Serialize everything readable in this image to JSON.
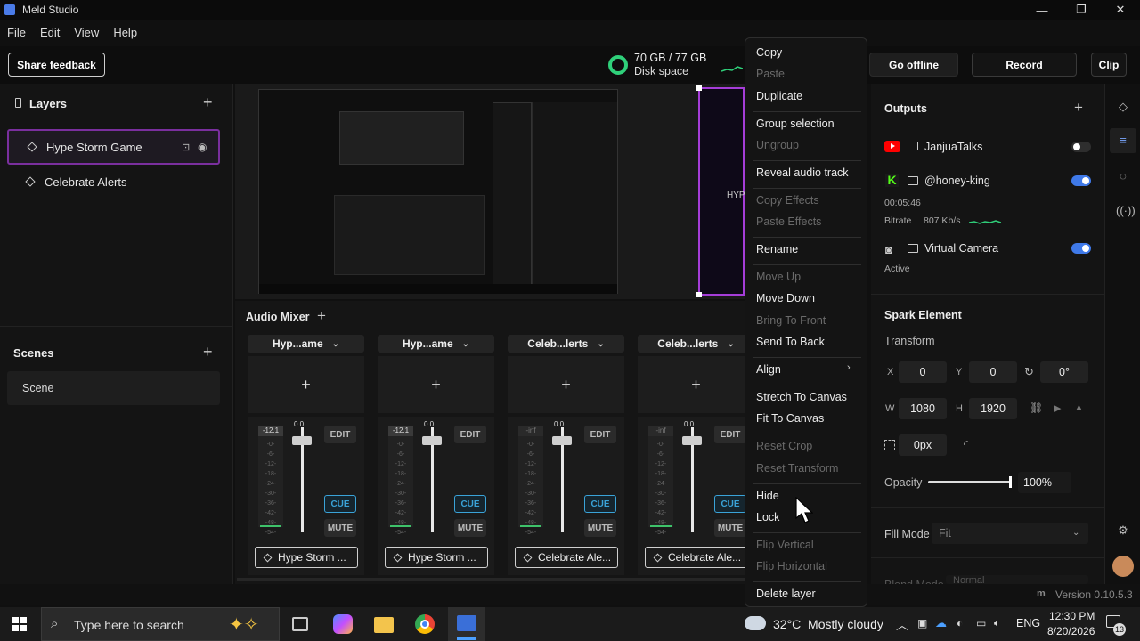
{
  "app": {
    "title": "Meld Studio"
  },
  "menu": [
    "File",
    "Edit",
    "View",
    "Help"
  ],
  "toolbar": {
    "share_feedback": "Share feedback",
    "disk_usage": "70 GB / 77 GB",
    "disk_label": "Disk space",
    "go_offline": "Go offline",
    "record": "Record",
    "clip": "Clip"
  },
  "layers": {
    "title": "Layers",
    "items": [
      {
        "label": "Hype Storm Game"
      },
      {
        "label": "Celebrate Alerts"
      }
    ]
  },
  "scenes": {
    "title": "Scenes",
    "items": [
      {
        "label": "Scene"
      }
    ]
  },
  "audio_mixer": {
    "title": "Audio Mixer",
    "strips": [
      {
        "header": "Hyp...ame",
        "level": "-12.1",
        "fader_value": "0.0",
        "edit": "EDIT",
        "cue": "CUE",
        "mute": "MUTE",
        "source": "Hype Storm ..."
      },
      {
        "header": "Hyp...ame",
        "level": "-12.1",
        "fader_value": "0.0",
        "edit": "EDIT",
        "cue": "CUE",
        "mute": "MUTE",
        "source": "Hype Storm ..."
      },
      {
        "header": "Celeb...lerts",
        "level": "-inf",
        "fader_value": "0.0",
        "edit": "EDIT",
        "cue": "CUE",
        "mute": "MUTE",
        "source": "Celebrate Ale..."
      },
      {
        "header": "Celeb...lerts",
        "level": "-inf",
        "fader_value": "0.0",
        "edit": "EDIT",
        "cue": "CUE",
        "mute": "MUTE",
        "source": "Celebrate Ale..."
      }
    ],
    "meter_ticks": [
      "-0-",
      "-6-",
      "-12-",
      "-18-",
      "-24-",
      "-30-",
      "-36-",
      "-42-",
      "-48-",
      "-54-"
    ]
  },
  "context_menu": {
    "copy": "Copy",
    "paste": "Paste",
    "duplicate": "Duplicate",
    "group_selection": "Group selection",
    "ungroup": "Ungroup",
    "reveal_audio_track": "Reveal audio track",
    "copy_effects": "Copy Effects",
    "paste_effects": "Paste Effects",
    "rename": "Rename",
    "move_up": "Move Up",
    "move_down": "Move Down",
    "bring_to_front": "Bring To Front",
    "send_to_back": "Send To Back",
    "align": "Align",
    "stretch_to_canvas": "Stretch To Canvas",
    "fit_to_canvas": "Fit To Canvas",
    "reset_crop": "Reset Crop",
    "reset_transform": "Reset Transform",
    "hide": "Hide",
    "lock": "Lock",
    "flip_vertical": "Flip Vertical",
    "flip_horizontal": "Flip Horizontal",
    "delete_layer": "Delete layer"
  },
  "outputs": {
    "title": "Outputs",
    "youtube": {
      "name": "JanjuaTalks",
      "enabled": false
    },
    "kick": {
      "name": "@honey-king",
      "enabled": true,
      "elapsed": "00:05:46",
      "bitrate_label": "Bitrate",
      "bitrate": "807 Kb/s"
    },
    "virtual_camera": {
      "name": "Virtual Camera",
      "enabled": true,
      "status": "Active"
    }
  },
  "spark": {
    "title": "Spark Element",
    "transform_label": "Transform",
    "x_label": "X",
    "x": "0",
    "y_label": "Y",
    "y": "0",
    "rotation": "0°",
    "w_label": "W",
    "w": "1080",
    "h_label": "H",
    "h": "1920",
    "corner": "0px",
    "opacity_label": "Opacity",
    "opacity": "100%",
    "fill_mode_label": "Fill Mode",
    "fill_mode": "Fit",
    "blend_mode_label": "Blend Mode",
    "blend_mode": "Normal"
  },
  "status": {
    "version": "Version 0.10.5.3"
  },
  "taskbar": {
    "search_placeholder": "Type here to search",
    "weather": "32°C  Mostly cloudy",
    "lang": "ENG",
    "time": "12:30 PM",
    "date": "8/20/2026",
    "notif_count": "13"
  },
  "colors": {
    "accent": "#3f79e8",
    "layer_selected_border": "#7a2f9e",
    "cue": "#3aa3d8",
    "disk_ring": "#2fd07a"
  }
}
